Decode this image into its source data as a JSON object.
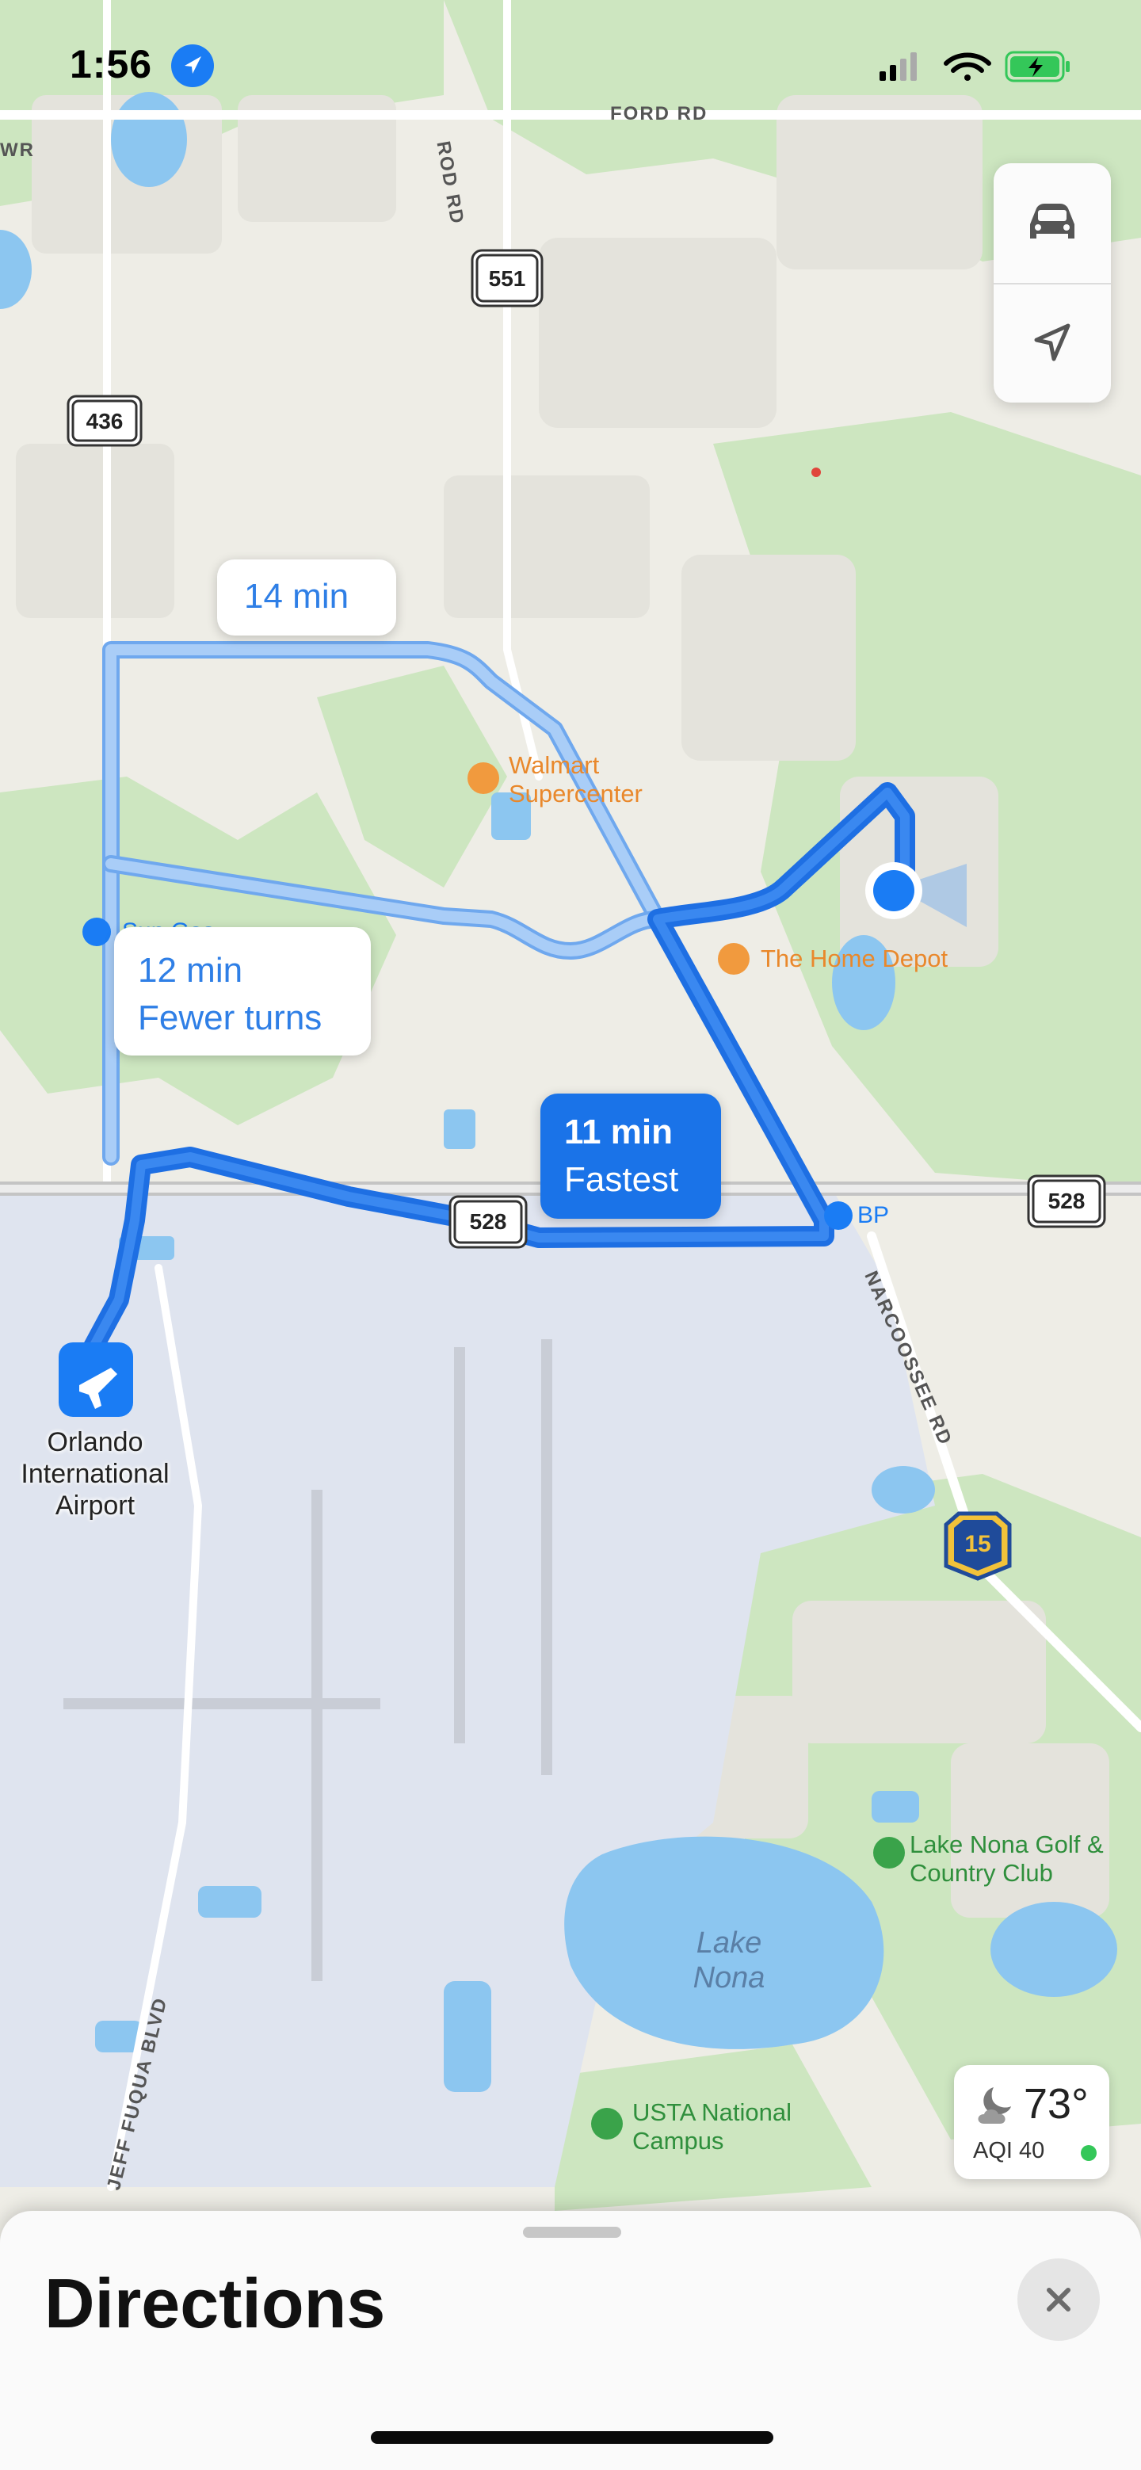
{
  "status_bar": {
    "time": "1:56",
    "location_icon": "location-arrow-icon",
    "signal_icon": "cellular-signal-icon",
    "wifi_icon": "wifi-icon",
    "battery_icon": "battery-charging-icon"
  },
  "map_controls": {
    "drive_mode_icon": "car-icon",
    "tracking_icon": "location-arrow-outline-icon"
  },
  "routes": [
    {
      "time": "14 min",
      "note": ""
    },
    {
      "time": "12 min",
      "note": "Fewer turns"
    },
    {
      "time": "11 min",
      "note": "Fastest"
    }
  ],
  "places": {
    "walmart": "Walmart\nSupercenter",
    "home_depot": "The Home Depot",
    "sun_gas": "Sun Gas",
    "bp": "BP",
    "airport": "Orlando\nInternational\nAirport",
    "golf": "Lake Nona Golf &\nCountry Club",
    "usta": "USTA National\nCampus",
    "lake": "Lake\nNona"
  },
  "roads": {
    "ford_rd": "FORD RD",
    "rod_rd": "ROD RD",
    "narcoossee": "NARCOOSSEE RD",
    "jeff_fuqua": "JEFF FUQUA BLVD",
    "wr": "WR"
  },
  "shields": {
    "sr551": "551",
    "sr436": "436",
    "sr528_center": "528",
    "sr528_right": "528",
    "cr15": "15"
  },
  "weather": {
    "temperature": "73°",
    "aqi": "AQI 40",
    "icon": "moon-cloud-icon"
  },
  "sheet": {
    "title": "Directions",
    "close_icon": "close-icon"
  },
  "colors": {
    "route_primary": "#1a73e8",
    "route_alt": "#9cc4f5",
    "park": "#cfe8c4",
    "water": "#8cc6f0",
    "airport": "#dde3ef"
  }
}
